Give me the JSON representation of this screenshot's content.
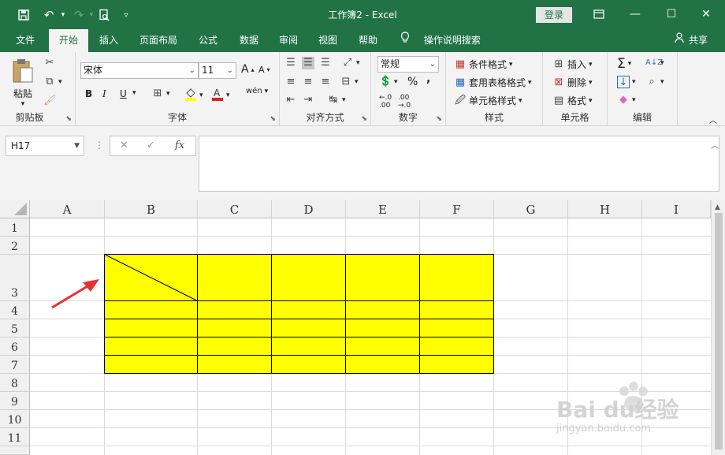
{
  "titlebar": {
    "title": "工作簿2  -  Excel",
    "login_label": "登录"
  },
  "menu": {
    "tabs": [
      "文件",
      "开始",
      "插入",
      "页面布局",
      "公式",
      "数据",
      "审阅",
      "视图",
      "帮助"
    ],
    "active_tab": "开始",
    "tell_me": "操作说明搜索",
    "share": "共享"
  },
  "ribbon": {
    "clipboard": {
      "paste": "粘贴",
      "label": "剪贴板"
    },
    "font": {
      "name": "宋体",
      "size": "11",
      "bold": "B",
      "italic": "I",
      "underline": "U",
      "grow": "A",
      "shrink": "A",
      "phonetic": "wén",
      "label": "字体"
    },
    "alignment": {
      "label": "对齐方式"
    },
    "number": {
      "format": "常规",
      "percent": "%",
      "comma": ",",
      "label": "数字"
    },
    "styles": {
      "conditional": "条件格式",
      "table": "套用表格格式",
      "cell": "单元格样式",
      "label": "样式"
    },
    "cells": {
      "insert": "插入",
      "delete": "删除",
      "format": "格式",
      "label": "单元格"
    },
    "editing": {
      "label": "编辑"
    }
  },
  "formula_bar": {
    "name_box": "H17",
    "fx": "fx",
    "value": ""
  },
  "sheet": {
    "columns": [
      "A",
      "B",
      "C",
      "D",
      "E",
      "F",
      "G",
      "H",
      "I"
    ],
    "rows": [
      "1",
      "2",
      "3",
      "4",
      "5",
      "6",
      "7",
      "8",
      "9",
      "10",
      "11"
    ],
    "table_fill": "#ffff00"
  },
  "watermark": {
    "brand": "Bai du经验",
    "url": "jingyan.baidu.com"
  },
  "colors": {
    "excel_green": "#217346",
    "annotation_arrow": "#e8322f"
  }
}
